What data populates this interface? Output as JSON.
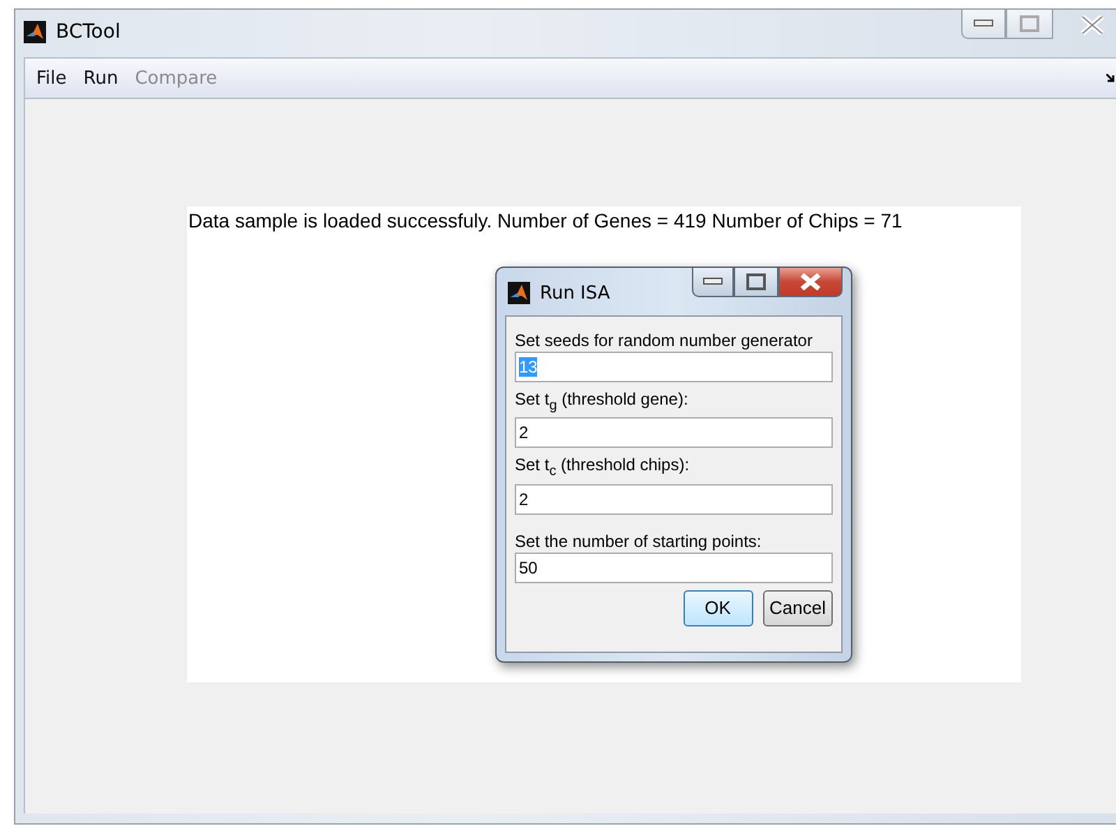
{
  "window": {
    "title": "BCTool"
  },
  "menu": [
    {
      "label": "File",
      "disabled": false
    },
    {
      "label": "Run",
      "disabled": false
    },
    {
      "label": "Compare",
      "disabled": true
    }
  ],
  "status_text": "Data sample is loaded successfuly. Number of Genes = 419 Number of Chips = 71",
  "dialog": {
    "title": "Run ISA",
    "fields": [
      {
        "label": "Set seeds for random number generator",
        "value": "13",
        "selected": true
      },
      {
        "label": "Set t$_{g}$ (threshold gene):",
        "value": "2",
        "selected": false
      },
      {
        "label": "Set t$_{c}$ (threshold chips):",
        "value": "2",
        "selected": false
      },
      {
        "label": "Set the number of starting points:",
        "value": "50",
        "selected": false
      }
    ],
    "buttons": [
      {
        "label": "OK",
        "default": true
      },
      {
        "label": "Cancel",
        "default": false
      }
    ]
  }
}
